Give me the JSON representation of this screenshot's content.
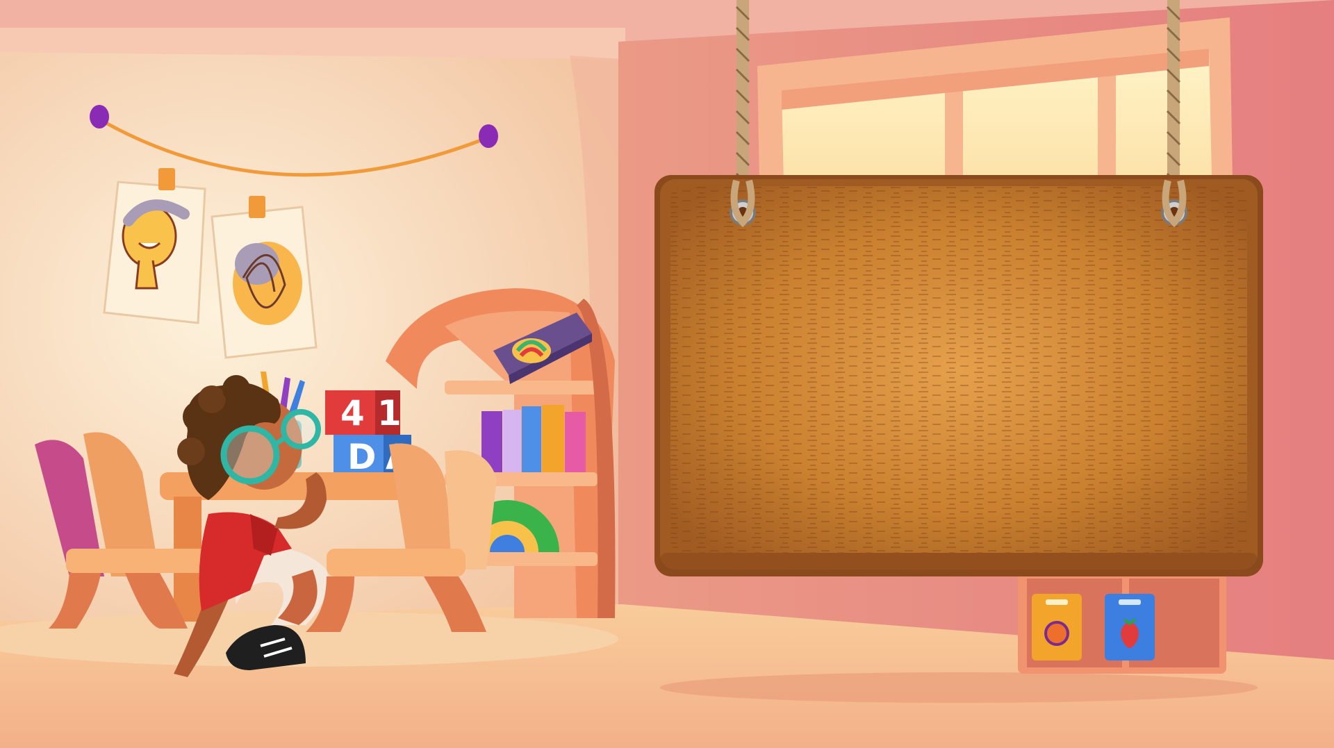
{
  "scene": {
    "description_free": true,
    "blocks": {
      "red": "4",
      "red_side": "1",
      "blue": "D",
      "blue_side": "A"
    },
    "sign_text": ""
  },
  "colors": {
    "wall_back": "#f8e6cc",
    "wall_right": "#ea8e84",
    "floor": "#f6c393",
    "wood_sign": "#c77a32",
    "wood_sign_dark": "#8a4a1c",
    "shirt": "#d72a2a",
    "glasses": "#2fb6a4",
    "pin": "#8a2bb6"
  },
  "icons": [
    "pin-icon",
    "rope",
    "drawing-face",
    "drawing-scribble",
    "letter-block",
    "bookshelf",
    "rainbow-toy",
    "pencil-cup",
    "fruit-box"
  ]
}
